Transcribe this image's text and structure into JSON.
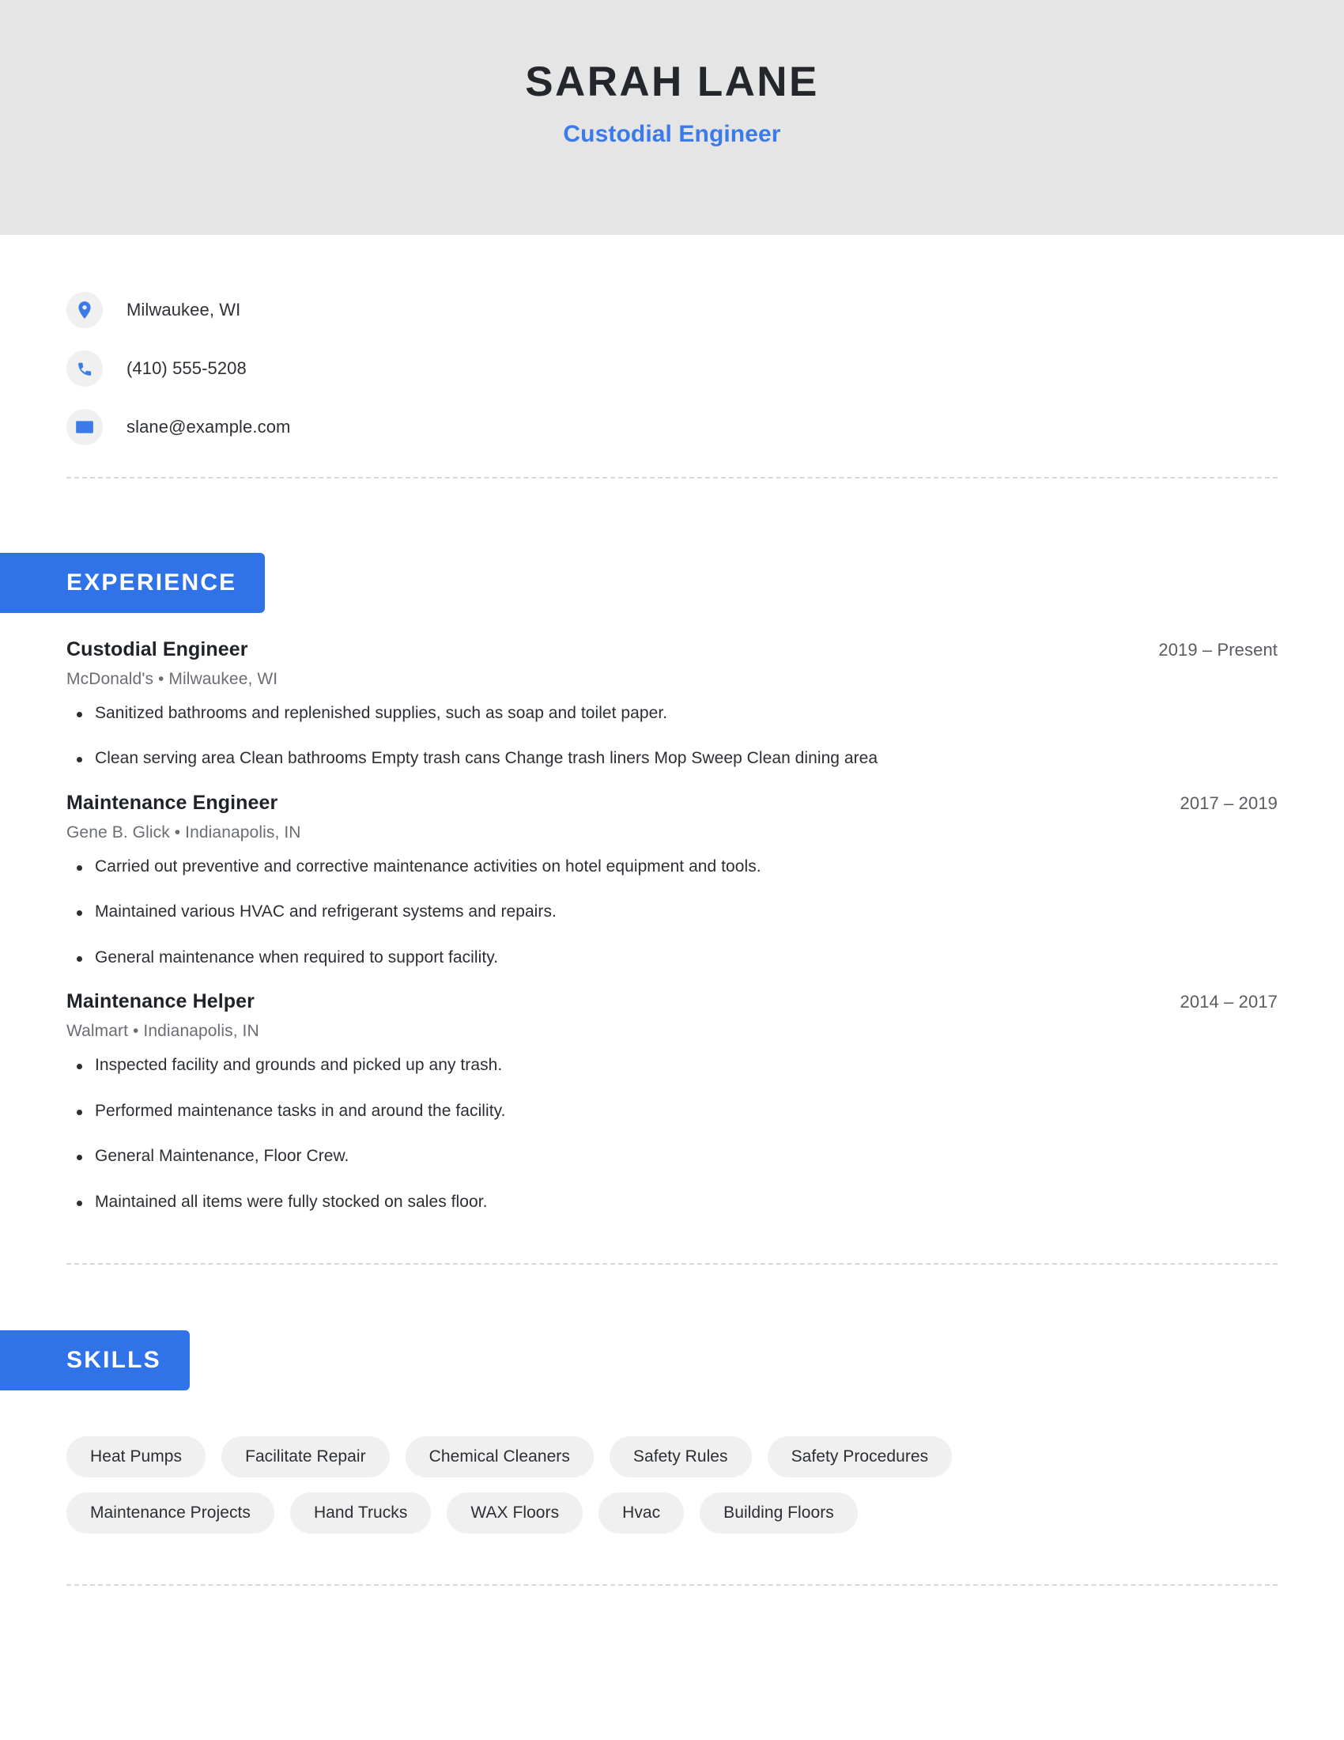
{
  "header": {
    "name": "SARAH LANE",
    "job_title": "Custodial Engineer",
    "background_color": "#e5e5e6",
    "name_color": "#23272b",
    "title_color": "#3b7ae8"
  },
  "accent_color": "#3072e8",
  "contact": {
    "items": [
      {
        "icon": "location-pin-icon",
        "value": "Milwaukee, WI"
      },
      {
        "icon": "phone-icon",
        "value": "(410) 555-5208"
      },
      {
        "icon": "envelope-icon",
        "value": "slane@example.com"
      }
    ]
  },
  "sections": [
    {
      "id": "experience",
      "label": "EXPERIENCE",
      "entries": [
        {
          "title": "Custodial Engineer",
          "date": "2019 – Present",
          "company": "McDonald's",
          "location": "Milwaukee, WI",
          "subtitle": "McDonald's • Milwaukee, WI",
          "bullets": [
            "Sanitized bathrooms and replenished supplies, such as soap and toilet paper.",
            "Clean serving area Clean bathrooms Empty trash cans Change trash liners Mop Sweep Clean dining area"
          ]
        },
        {
          "title": "Maintenance Engineer",
          "date": "2017 – 2019",
          "company": "Gene B. Glick",
          "location": "Indianapolis, IN",
          "subtitle": "Gene B. Glick • Indianapolis, IN",
          "bullets": [
            "Carried out preventive and corrective maintenance activities on hotel equipment and tools.",
            "Maintained various HVAC and refrigerant systems and repairs.",
            "General maintenance when required to support facility."
          ]
        },
        {
          "title": "Maintenance Helper",
          "date": "2014 – 2017",
          "company": "Walmart",
          "location": "Indianapolis, IN",
          "subtitle": "Walmart • Indianapolis, IN",
          "bullets": [
            "Inspected facility and grounds and picked up any trash.",
            "Performed maintenance tasks in and around the facility.",
            "General Maintenance, Floor Crew.",
            "Maintained all items were fully stocked on sales floor."
          ]
        }
      ]
    },
    {
      "id": "skills",
      "label": "SKILLS",
      "pills": [
        "Heat Pumps",
        "Facilitate Repair",
        "Chemical Cleaners",
        "Safety Rules",
        "Safety Procedures",
        "Maintenance Projects",
        "Hand Trucks",
        "WAX Floors",
        "Hvac",
        "Building Floors"
      ]
    }
  ]
}
